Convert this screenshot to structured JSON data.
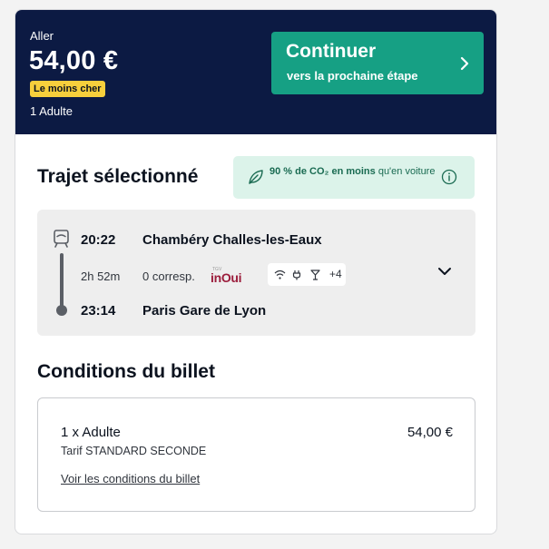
{
  "header": {
    "direction": "Aller",
    "price": "54,00 €",
    "badge": "Le moins cher",
    "passengers": "1 Adulte",
    "continue_label": "Continuer",
    "continue_sub": "vers la prochaine étape"
  },
  "trip": {
    "title": "Trajet sélectionné",
    "co2_bold": "90 % de CO₂ en moins",
    "co2_rest": " qu'en voiture",
    "departure_time": "20:22",
    "departure_station": "Chambéry Challes-les-Eaux",
    "duration": "2h 52m",
    "connections": "0 corresp.",
    "brand_small": "TGV",
    "brand": "inOui",
    "services_more": "+4",
    "arrival_time": "23:14",
    "arrival_station": "Paris Gare de Lyon"
  },
  "conditions": {
    "title": "Conditions du billet",
    "passenger": "1 x Adulte",
    "fare": "Tarif STANDARD SECONDE",
    "amount": "54,00 €",
    "link": "Voir les conditions du billet"
  },
  "icons": [
    "chevron-right-icon",
    "leaf-icon",
    "info-icon",
    "train-icon",
    "wifi-icon",
    "power-plug-icon",
    "bar-icon",
    "chevron-down-icon"
  ],
  "colors": {
    "header_bg": "#0c1a43",
    "accent": "#16a084",
    "badge": "#f7cf3c",
    "co2_bg": "#dcf3ea",
    "brand": "#9b1c3b"
  }
}
